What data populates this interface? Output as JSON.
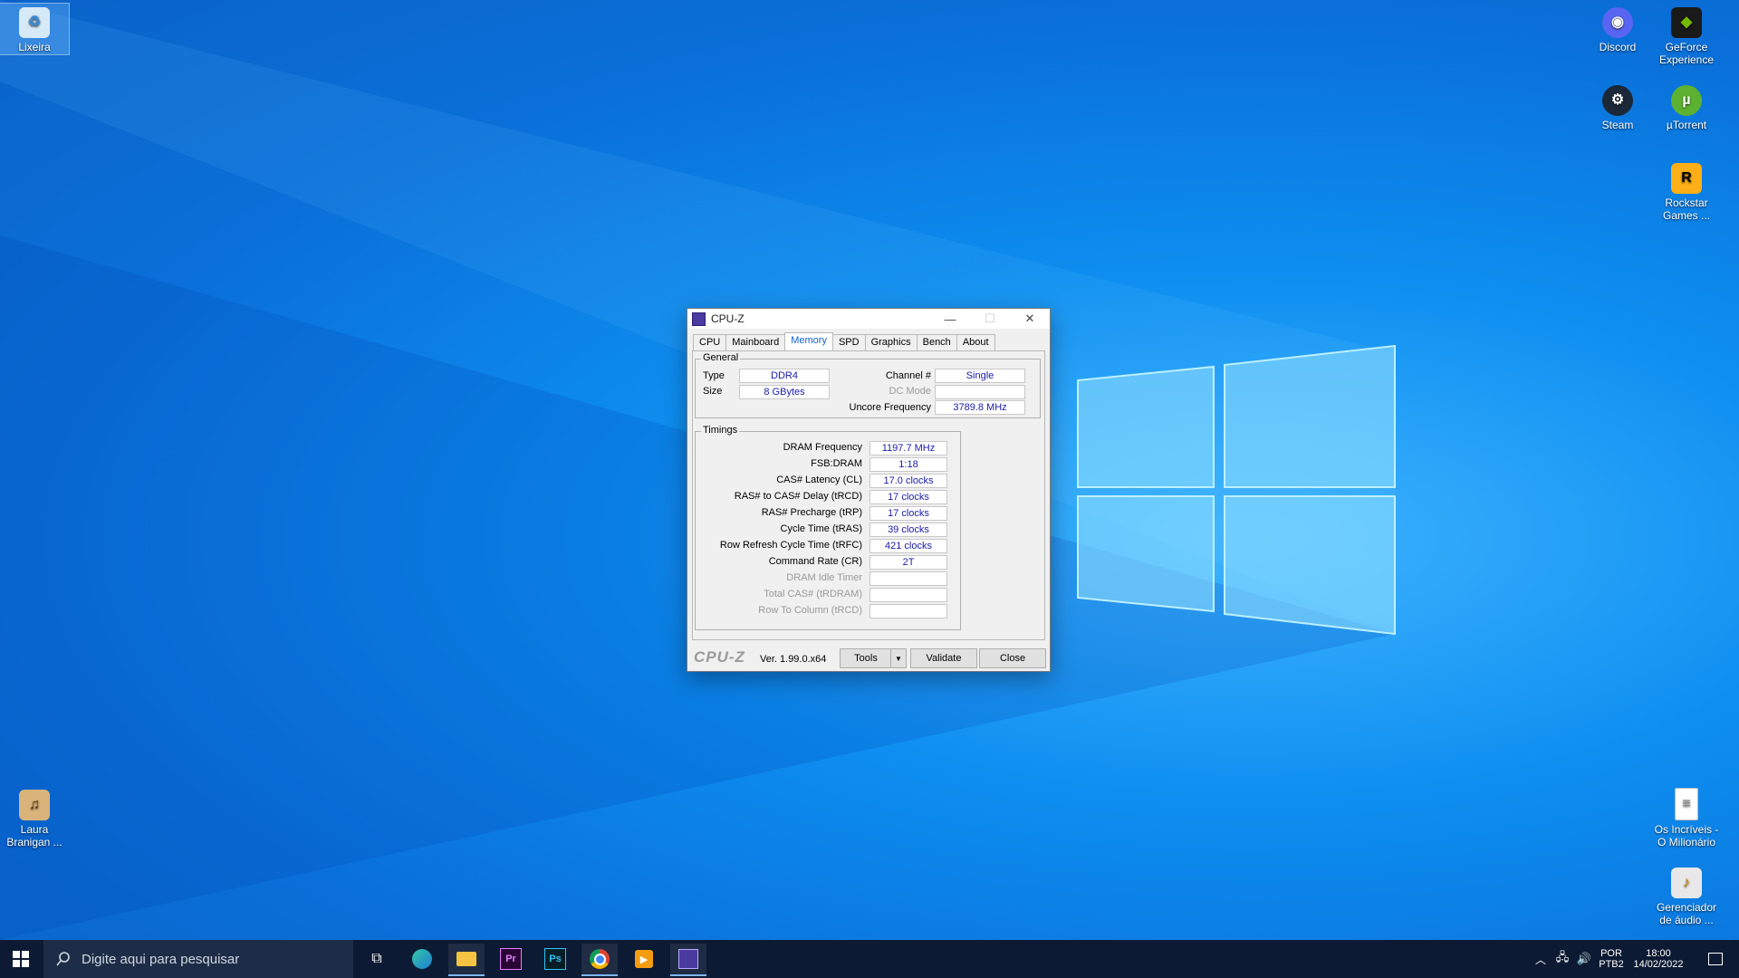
{
  "desktop": {
    "icons_left": [
      {
        "label": "Lixeira"
      },
      {
        "label": "Laura Branigan ..."
      }
    ],
    "icons_right": [
      {
        "label": "Discord"
      },
      {
        "label": "GeForce Experience"
      },
      {
        "label": "Steam"
      },
      {
        "label": "µTorrent"
      },
      {
        "label": "Rockstar Games ..."
      },
      {
        "label": "Os Incríveis - O Milionário"
      },
      {
        "label": "Gerenciador de áudio ..."
      }
    ]
  },
  "window": {
    "title": "CPU-Z",
    "tabs": [
      "CPU",
      "Mainboard",
      "Memory",
      "SPD",
      "Graphics",
      "Bench",
      "About"
    ],
    "active_tab": "Memory",
    "general": {
      "legend": "General",
      "type_label": "Type",
      "type_value": "DDR4",
      "size_label": "Size",
      "size_value": "8 GBytes",
      "channel_label": "Channel #",
      "channel_value": "Single",
      "dcmode_label": "DC Mode",
      "dcmode_value": "",
      "uncore_label": "Uncore Frequency",
      "uncore_value": "3789.8 MHz"
    },
    "timings": {
      "legend": "Timings",
      "rows": [
        {
          "label": "DRAM Frequency",
          "value": "1197.7 MHz",
          "dim": false
        },
        {
          "label": "FSB:DRAM",
          "value": "1:18",
          "dim": false
        },
        {
          "label": "CAS# Latency (CL)",
          "value": "17.0 clocks",
          "dim": false
        },
        {
          "label": "RAS# to CAS# Delay (tRCD)",
          "value": "17 clocks",
          "dim": false
        },
        {
          "label": "RAS# Precharge (tRP)",
          "value": "17 clocks",
          "dim": false
        },
        {
          "label": "Cycle Time (tRAS)",
          "value": "39 clocks",
          "dim": false
        },
        {
          "label": "Row Refresh Cycle Time (tRFC)",
          "value": "421 clocks",
          "dim": false
        },
        {
          "label": "Command Rate (CR)",
          "value": "2T",
          "dim": false
        },
        {
          "label": "DRAM Idle Timer",
          "value": "",
          "dim": true
        },
        {
          "label": "Total CAS# (tRDRAM)",
          "value": "",
          "dim": true
        },
        {
          "label": "Row To Column (tRCD)",
          "value": "",
          "dim": true
        }
      ]
    },
    "footer": {
      "logo": "CPU-Z",
      "version": "Ver. 1.99.0.x64",
      "tools": "Tools",
      "validate": "Validate",
      "close": "Close"
    }
  },
  "taskbar": {
    "search_placeholder": "Digite aqui para pesquisar",
    "lang1": "POR",
    "lang2": "PTB2",
    "time": "18:00",
    "date": "14/02/2022"
  }
}
